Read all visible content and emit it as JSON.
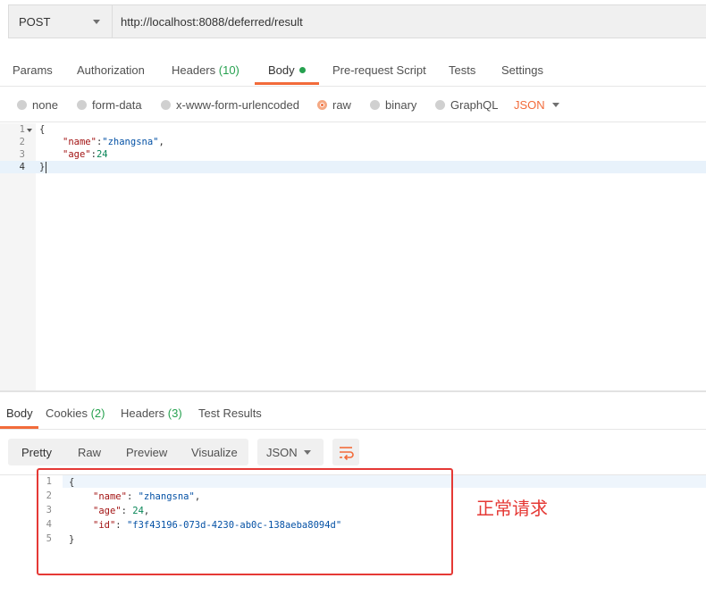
{
  "request": {
    "method": "POST",
    "url": "http://localhost:8088/deferred/result"
  },
  "request_tabs": [
    {
      "label": "Params"
    },
    {
      "label": "Authorization"
    },
    {
      "label": "Headers",
      "count": "(10)"
    },
    {
      "label": "Body",
      "active": true
    },
    {
      "label": "Pre-request Script"
    },
    {
      "label": "Tests"
    },
    {
      "label": "Settings"
    }
  ],
  "body_options": {
    "none": "none",
    "form_data": "form-data",
    "x_www": "x-www-form-urlencoded",
    "raw": "raw",
    "binary": "binary",
    "graphql": "GraphQL",
    "selected": "raw",
    "format": "JSON"
  },
  "request_editor": {
    "line_numbers": [
      "1",
      "2",
      "3",
      "4"
    ],
    "lines": {
      "l1": "{",
      "l2_key": "\"name\"",
      "l2_colon": ":",
      "l2_val": "\"zhangsna\"",
      "l2_comma": ",",
      "l3_key": "\"age\"",
      "l3_colon": ":",
      "l3_val": "24",
      "l4": "}"
    }
  },
  "response_tabs": {
    "body": "Body",
    "cookies": "Cookies",
    "cookies_count": "(2)",
    "headers": "Headers",
    "headers_count": "(3)",
    "test_results": "Test Results"
  },
  "response_toolbar": {
    "pretty": "Pretty",
    "raw": "Raw",
    "preview": "Preview",
    "visualize": "Visualize",
    "format": "JSON"
  },
  "response_body": {
    "line_numbers": [
      "1",
      "2",
      "3",
      "4",
      "5"
    ],
    "l1": "{",
    "name_key": "\"name\"",
    "name_val": "\"zhangsna\"",
    "age_key": "\"age\"",
    "age_val": "24",
    "id_key": "\"id\"",
    "id_val": "\"f3f43196-073d-4230-ab0c-138aeba8094d\"",
    "l5": "}"
  },
  "annotation": "正常请求",
  "colors": {
    "accent": "#f26b3a",
    "count_green": "#26a14f",
    "annotation_red": "#e53935"
  }
}
